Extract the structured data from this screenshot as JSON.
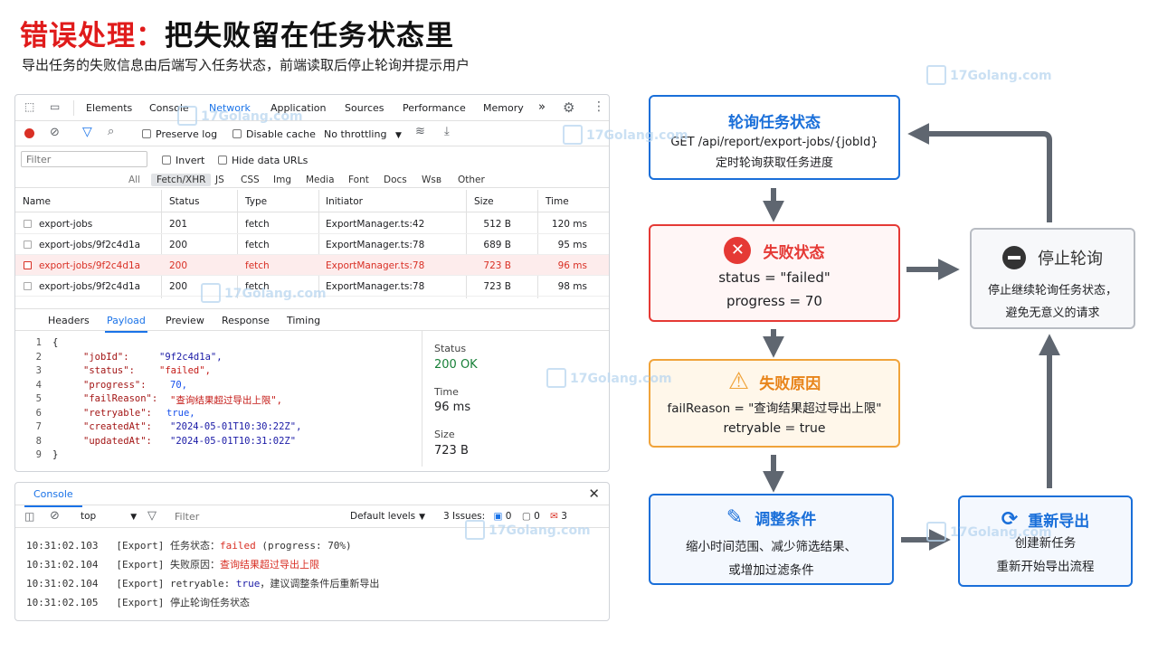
{
  "title": {
    "red": "错误处理：",
    "black": "把失败留在任务状态里"
  },
  "subtitle": "导出任务的失败信息由后端写入任务状态，前端读取后停止轮询并提示用户",
  "devtools": {
    "tabs": [
      "Elements",
      "Console",
      "Network",
      "Application",
      "Sources",
      "Performance",
      "Memory"
    ],
    "more": "»",
    "toolbar": {
      "preserve_log": "Preserve log",
      "disable_cache": "Disable cache",
      "throttling": "No throttling"
    },
    "filter": {
      "placeholder": "Filter",
      "invert": "Invert",
      "hide_data_urls": "Hide data URLs"
    },
    "types": [
      "All",
      "Fetch/XHR",
      "JS",
      "CSS",
      "Img",
      "Media",
      "Font",
      "Docs",
      "Wsв",
      "Other"
    ],
    "columns": [
      "Name",
      "Status",
      "Type",
      "Initiator",
      "Size",
      "Time"
    ],
    "rows": [
      {
        "name": "export-jobs",
        "status": "201",
        "type": "fetch",
        "initiator": "ExportManager.ts:42",
        "size": "512 B",
        "time": "120 ms"
      },
      {
        "name": "export-jobs/9f2c4d1a",
        "status": "200",
        "type": "fetch",
        "initiator": "ExportManager.ts:78",
        "size": "689 B",
        "time": "95 ms"
      },
      {
        "name": "export-jobs/9f2c4d1a",
        "status": "200",
        "type": "fetch",
        "initiator": "ExportManager.ts:78",
        "size": "723 B",
        "time": "96 ms"
      },
      {
        "name": "export-jobs/9f2c4d1a",
        "status": "200",
        "type": "fetch",
        "initiator": "ExportManager.ts:78",
        "size": "723 B",
        "time": "98 ms"
      }
    ],
    "detail_tabs": [
      "Headers",
      "Payload",
      "Preview",
      "Response",
      "Timing"
    ],
    "code_lines": [
      "1",
      "2",
      "3",
      "4",
      "5",
      "6",
      "7",
      "8",
      "9"
    ],
    "json_keys": {
      "jobId": "\"jobId\":",
      "status": "\"status\":",
      "progress": "\"progress\":",
      "failReason": "\"failReason\":",
      "retryable": "\"retryable\":",
      "createdAt": "\"createdAt\":",
      "updatedAt": "\"updatedAt\":"
    },
    "json_vals": {
      "jobId": "\"9f2c4d1a\",",
      "status": "\"failed\",",
      "progress": "70,",
      "failReason": "\"查询结果超过导出上限\",",
      "retryable": "true,",
      "createdAt": "\"2024-05-01T10:30:22Z\",",
      "updatedAt": "\"2024-05-01T10:31:02Z\""
    },
    "brace_open": "{",
    "brace_close": "}",
    "meta": {
      "status_label": "Status",
      "status_value": "200  OK",
      "time_label": "Time",
      "time_value": "96 ms",
      "size_label": "Size",
      "size_value": "723 B"
    }
  },
  "console": {
    "tab": "Console",
    "context": "top",
    "filter_placeholder": "Filter",
    "levels": "Default levels",
    "issues_label": "3 Issues:",
    "issue_counts": [
      "0",
      "0",
      "3"
    ],
    "logs": [
      {
        "time": "10:31:02.103",
        "tag": "[Export]",
        "text": "任务状态：",
        "hl": "failed",
        "rest": " (progress: 70%)"
      },
      {
        "time": "10:31:02.104",
        "tag": "[Export]",
        "text": "失败原因：",
        "hl": "查询结果超过导出上限",
        "rest": ""
      },
      {
        "time": "10:31:02.104",
        "tag": "[Export]",
        "text": "retryable: ",
        "hl": "true",
        "rest": "，建议调整条件后重新导出"
      },
      {
        "time": "10:31:02.105",
        "tag": "[Export]",
        "text": "停止轮询任务状态",
        "hl": "",
        "rest": ""
      }
    ]
  },
  "flow": {
    "poll": {
      "title": "轮询任务状态",
      "line1": "GET /api/report/export-jobs/{jobId}",
      "line2": "定时轮询获取任务进度"
    },
    "fail": {
      "title": "失败状态",
      "line1": "status = \"failed\"",
      "line2": "progress = 70"
    },
    "reason": {
      "title": "失败原因",
      "line1": "failReason = \"查询结果超过导出上限\"",
      "line2": "retryable = true"
    },
    "adjust": {
      "title": "调整条件",
      "line1": "缩小时间范围、减少筛选结果、",
      "line2": "或增加过滤条件"
    },
    "stop": {
      "title": "停止轮询",
      "line1": "停止继续轮询任务状态，",
      "line2": "避免无意义的请求"
    },
    "reexport": {
      "title": "重新导出",
      "line1": "创建新任务",
      "line2": "重新开始导出流程"
    }
  },
  "watermark": "17Golang.com",
  "colors": {
    "accent": "#1a6fd9",
    "error": "#e53935",
    "warning": "#f0a33a",
    "arrow": "#5f6670"
  }
}
